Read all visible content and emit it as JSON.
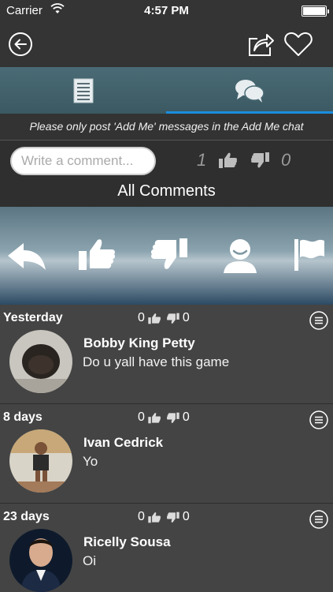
{
  "status_bar": {
    "carrier": "Carrier",
    "time": "4:57 PM",
    "battery_level": 1.0
  },
  "nav": {
    "back_icon": "back-circle-icon",
    "share_icon": "share-icon",
    "favorite_icon": "heart-icon"
  },
  "tabs": [
    {
      "icon": "document-icon",
      "active": false
    },
    {
      "icon": "chat-bubbles-icon",
      "active": true
    }
  ],
  "notice": "Please only post 'Add Me' messages in the Add Me chat",
  "compose": {
    "placeholder": "Write a comment...",
    "likes": "1",
    "dislikes": "0",
    "section_title": "All Comments"
  },
  "actions": [
    "reply-icon",
    "thumb-up-icon",
    "thumb-down-icon",
    "user-icon",
    "flag-icon"
  ],
  "comments": [
    {
      "date": "Yesterday",
      "likes": "0",
      "dislikes": "0",
      "name": "Bobby King Petty",
      "text": "Do u yall have this game"
    },
    {
      "date": "8 days",
      "likes": "0",
      "dislikes": "0",
      "name": "Ivan Cedrick",
      "text": "Yo"
    },
    {
      "date": "23 days",
      "likes": "0",
      "dislikes": "0",
      "name": "Ricelly Sousa",
      "text": "Oi"
    }
  ],
  "colors": {
    "accent": "#1a8de0",
    "background": "#444444",
    "nav": "#343434"
  }
}
